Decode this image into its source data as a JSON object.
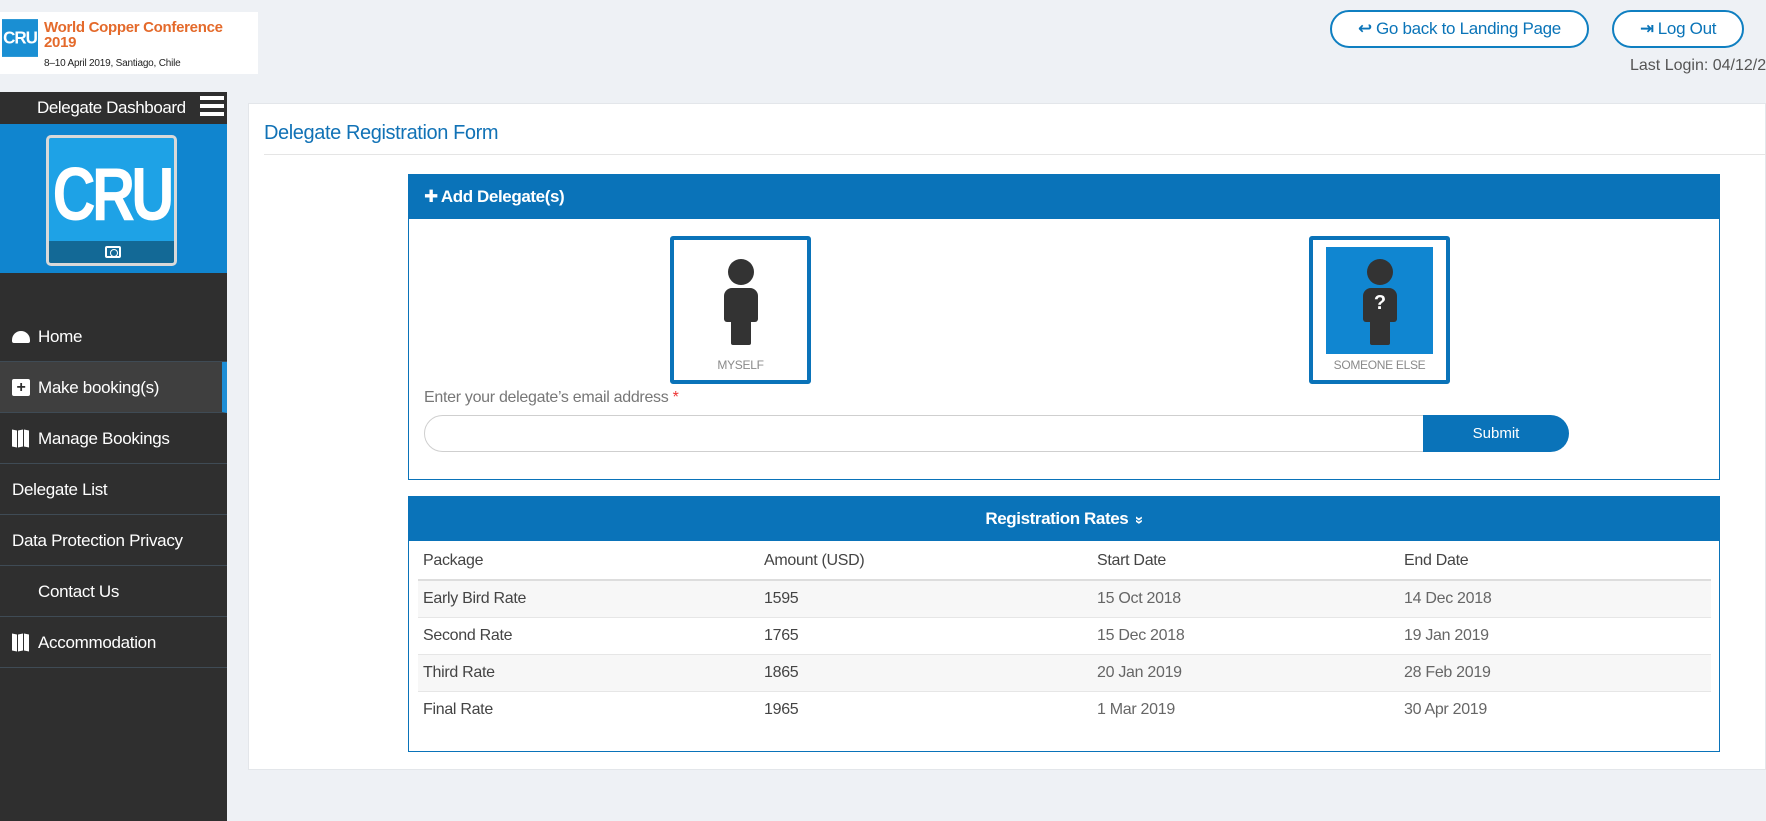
{
  "header": {
    "logo": {
      "mark": "CRU",
      "title": "World Copper Conference 2019",
      "subtitle": "8–10 April 2019, Santiago, Chile"
    },
    "back_button": {
      "icon": "reply-icon",
      "glyph": "↩",
      "label": "Go back to Landing Page"
    },
    "logout_button": {
      "icon": "logout-icon",
      "glyph": "⇥",
      "label": "Log Out"
    },
    "last_login": "Last Login: 04/12/2"
  },
  "sidebar": {
    "title": "Delegate Dashboard",
    "menu_icon": "hamburger-icon",
    "avatar_text": "CRU",
    "avatar_icon": "camera-icon",
    "items": [
      {
        "label": "Home",
        "icon": "dashboard-icon"
      },
      {
        "label": "Make booking(s)",
        "icon": "plus-square-icon",
        "active": true
      },
      {
        "label": "Manage Bookings",
        "icon": "map-icon"
      },
      {
        "label": "Delegate List",
        "icon": ""
      },
      {
        "label": "Data Protection Privacy",
        "icon": ""
      },
      {
        "label": "Contact Us",
        "icon": "blank-icon"
      },
      {
        "label": "Accommodation",
        "icon": "map-icon"
      }
    ]
  },
  "main": {
    "title": "Delegate Registration Form",
    "add_panel": {
      "heading_glyph": "✚",
      "heading": "Add Delegate(s)",
      "option_myself": "MYSELF",
      "option_someone_else": "SOMEONE ELSE",
      "someone_else_glyph": "?",
      "email_label": "Enter your delegate’s email address",
      "required_mark": "*",
      "email_value": "",
      "email_placeholder": "",
      "submit_label": "Submit"
    },
    "rates_panel": {
      "heading": "Registration Rates",
      "heading_glyph": "»",
      "columns": [
        "Package",
        "Amount (USD)",
        "Start Date",
        "End Date"
      ],
      "rows": [
        [
          "Early Bird Rate",
          "1595",
          "15 Oct 2018",
          "14 Dec 2018"
        ],
        [
          "Second Rate",
          "1765",
          "15 Dec 2018",
          "19 Jan 2019"
        ],
        [
          "Third Rate",
          "1865",
          "20 Jan 2019",
          "28 Feb 2019"
        ],
        [
          "Final Rate",
          "1965",
          "1 Mar 2019",
          "30 Apr 2019"
        ]
      ]
    }
  },
  "colors": {
    "brand_blue": "#0a73b9",
    "sidebar_bg": "#2f2f2f",
    "logo_orange": "#e46a2b",
    "active_indicator": "#1e8ed6"
  }
}
